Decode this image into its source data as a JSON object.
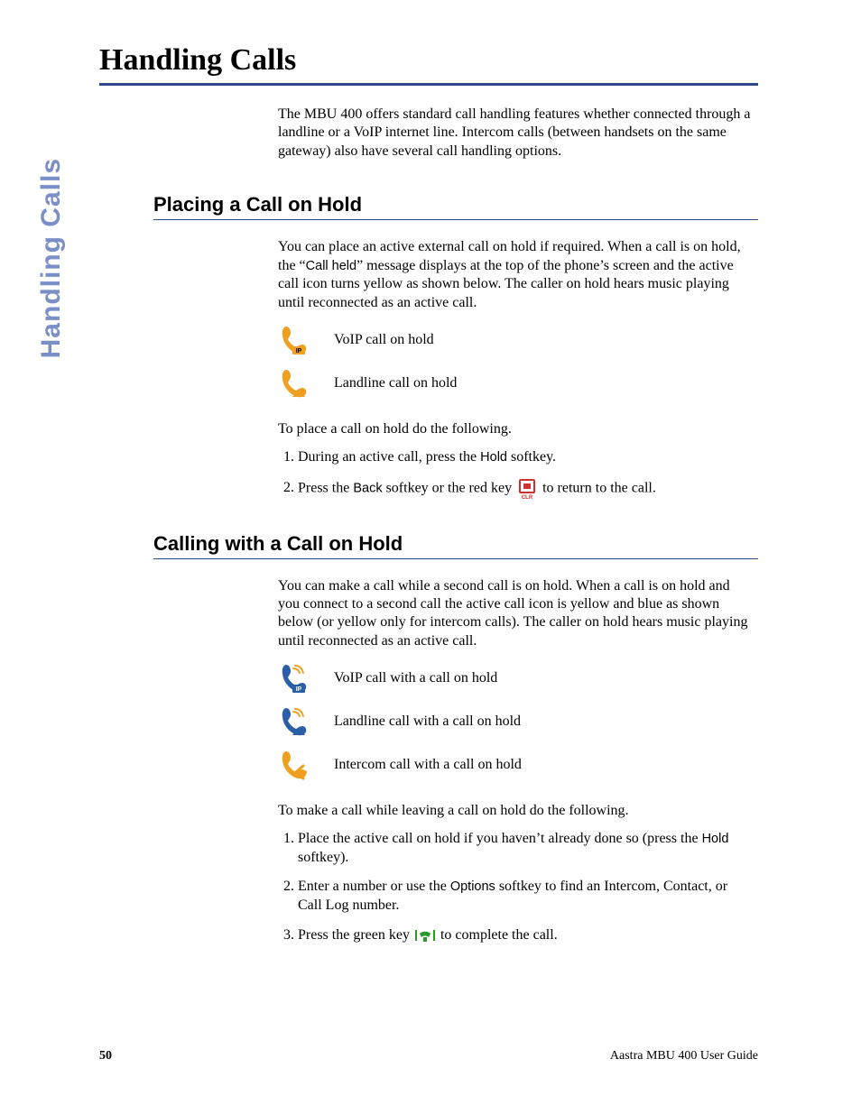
{
  "sideTab": "Handling Calls",
  "title": "Handling Calls",
  "intro": "The MBU 400 offers standard call handling features whether connected through a landline or a VoIP internet line. Intercom calls (between handsets on the same gateway) also have several call handling options.",
  "section1": {
    "heading": "Placing a Call on Hold",
    "para_a": "You can place an active external call on hold if required. When a call is on hold, the “",
    "callHeld": "Call held",
    "para_b": "” message displays at the top of the phone’s screen and the active call icon turns yellow as shown below. The caller on hold hears music playing until reconnected as an active call.",
    "icon1Label": "VoIP call on hold",
    "icon2Label": "Landline call on hold",
    "lead": "To place a call on hold do the following.",
    "step1_a": "During an active call, press the ",
    "holdKey": "Hold",
    "step1_b": " softkey.",
    "step2_a": "Press the ",
    "backKey": "Back",
    "step2_b": " softkey or the red key ",
    "step2_c": " to return to the call."
  },
  "section2": {
    "heading": "Calling with a Call on Hold",
    "para": "You can make a call while a second call is on hold. When a call is on hold and you connect to a second call the active call icon is yellow and blue as shown below (or yellow only for intercom calls). The caller on hold hears music playing until reconnected as an active call.",
    "icon1Label": "VoIP call with a call on hold",
    "icon2Label": "Landline call with a call on hold",
    "icon3Label": "Intercom call with a call on hold",
    "lead": "To make a call while leaving a call on hold do the following.",
    "step1_a": "Place the active call on hold if you haven’t already done so (press the ",
    "holdKey": "Hold",
    "step1_b": " softkey).",
    "step2_a": "Enter a number or use the ",
    "optionsKey": "Options",
    "step2_b": " softkey to find an Intercom, Contact, or Call Log number.",
    "step3_a": "Press the green key ",
    "step3_b": " to complete the call."
  },
  "footer": {
    "page": "50",
    "guide": "Aastra MBU 400 User Guide"
  }
}
